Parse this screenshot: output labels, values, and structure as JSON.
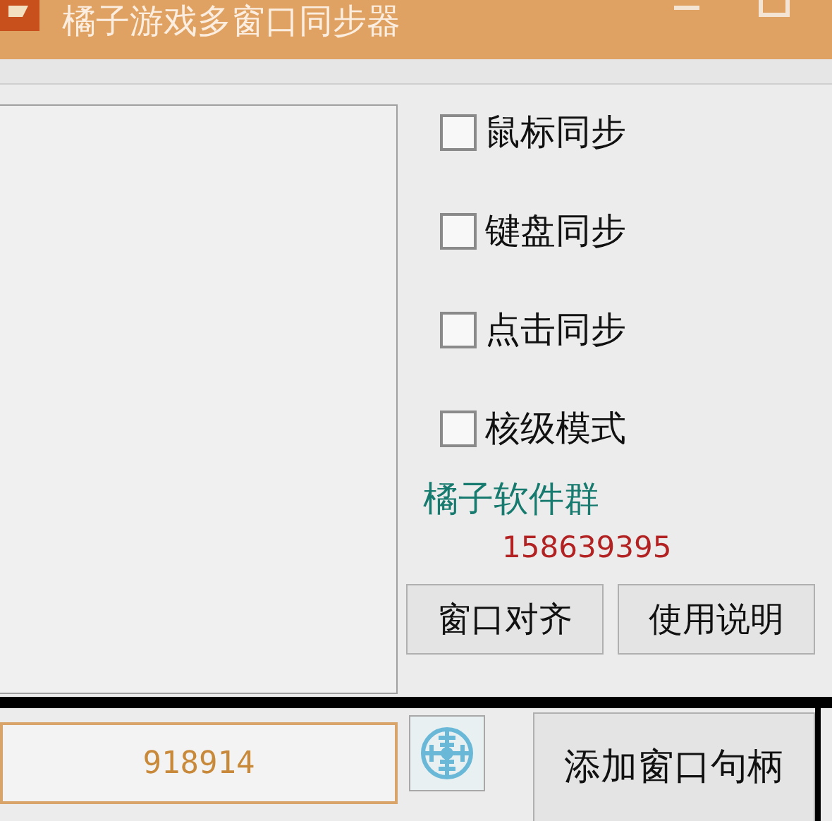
{
  "window": {
    "title": "橘子游戏多窗口同步器"
  },
  "options": [
    {
      "label": "鼠标同步",
      "checked": false
    },
    {
      "label": "键盘同步",
      "checked": false
    },
    {
      "label": "点击同步",
      "checked": false
    },
    {
      "label": "核级模式",
      "checked": false
    }
  ],
  "group_label": "橘子软件群",
  "group_number": "158639395",
  "buttons": [
    "窗口对齐",
    "使用说明"
  ],
  "code_field": {
    "value": "918914"
  },
  "add_button": "添加窗口句柄"
}
